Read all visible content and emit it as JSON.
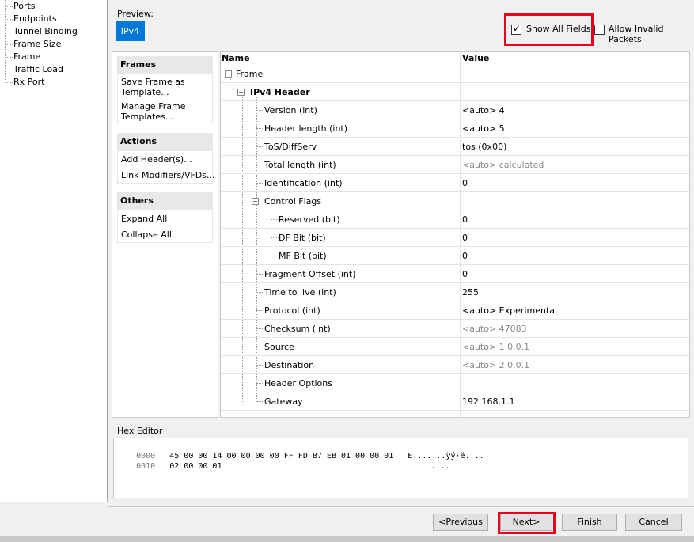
{
  "nav": {
    "items": [
      "Ports",
      "Endpoints",
      "Tunnel Binding",
      "Frame Size",
      "Frame",
      "Traffic Load",
      "Rx Port"
    ]
  },
  "preview": {
    "label": "Preview:",
    "protocol": "IPv4"
  },
  "options": {
    "show_all_fields": {
      "label": "Show All Fields",
      "checked": true
    },
    "allow_invalid": {
      "label": "Allow Invalid Packets",
      "checked": false
    }
  },
  "side": {
    "frames": {
      "heading": "Frames",
      "links": [
        "Save Frame as Template...",
        "Manage Frame Templates..."
      ]
    },
    "actions": {
      "heading": "Actions",
      "links": [
        "Add Header(s)...",
        "Link Modifiers/VFDs..."
      ]
    },
    "others": {
      "heading": "Others",
      "links": [
        "Expand All",
        "Collapse All"
      ]
    }
  },
  "grid": {
    "col_name": "Name",
    "col_value": "Value",
    "rows": [
      {
        "name": "Frame",
        "value": ""
      },
      {
        "name": "IPv4 Header",
        "value": ""
      },
      {
        "name": "Version (int)",
        "value": "<auto> 4"
      },
      {
        "name": "Header length (int)",
        "value": "<auto> 5"
      },
      {
        "name": "ToS/DiffServ",
        "value": "tos (0x00)"
      },
      {
        "name": "Total length (int)",
        "value": "<auto> calculated"
      },
      {
        "name": "Identification (int)",
        "value": "0"
      },
      {
        "name": "Control Flags",
        "value": ""
      },
      {
        "name": "Reserved (bit)",
        "value": "0"
      },
      {
        "name": "DF Bit (bit)",
        "value": "0"
      },
      {
        "name": "MF Bit (bit)",
        "value": "0"
      },
      {
        "name": "Fragment Offset (int)",
        "value": "0"
      },
      {
        "name": "Time to live (int)",
        "value": "255"
      },
      {
        "name": "Protocol (int)",
        "value": "<auto> Experimental"
      },
      {
        "name": "Checksum (int)",
        "value": "<auto> 47083"
      },
      {
        "name": "Source",
        "value": "<auto> 1.0.0.1"
      },
      {
        "name": "Destination",
        "value": "<auto> 2.0.0.1"
      },
      {
        "name": "Header Options",
        "value": ""
      },
      {
        "name": "Gateway",
        "value": "192.168.1.1"
      }
    ]
  },
  "hex": {
    "label": "Hex Editor",
    "lines": [
      {
        "offset": "0000",
        "bytes": "45 00 00 14 00 00 00 00 FF FD B7 EB 01 00 00 01",
        "ascii": "E.......ÿý·ë...."
      },
      {
        "offset": "0010",
        "bytes": "02 00 00 01",
        "ascii": "...."
      }
    ]
  },
  "buttons": {
    "previous": "<Previous",
    "next": "Next>",
    "finish": "Finish",
    "cancel": "Cancel"
  },
  "colors": {
    "accent": "#0078d7",
    "highlight": "#e8001c"
  }
}
